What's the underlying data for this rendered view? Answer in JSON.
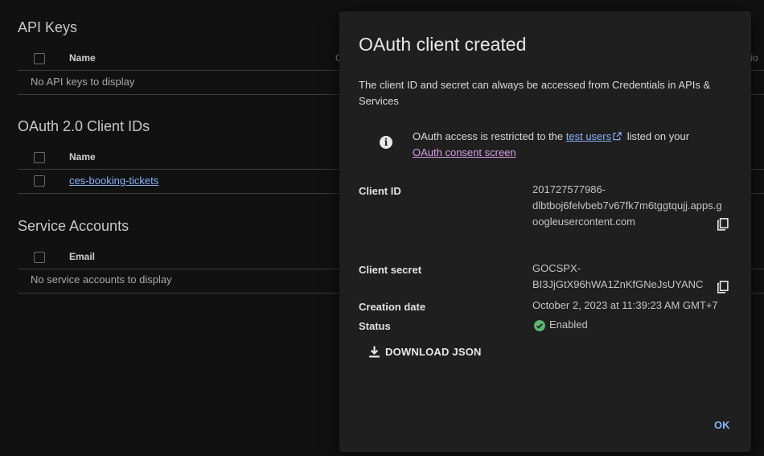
{
  "api_keys": {
    "title": "API Keys",
    "col_name": "Name",
    "col_clip": "C",
    "col_clip_right": "tio",
    "empty": "No API keys to display"
  },
  "oauth": {
    "title": "OAuth 2.0 Client IDs",
    "col_name": "Name",
    "rows": [
      {
        "name": "ces-booking-tickets"
      }
    ]
  },
  "service_accounts": {
    "title": "Service Accounts",
    "col_email": "Email",
    "empty": "No service accounts to display"
  },
  "dialog": {
    "title": "OAuth client created",
    "description": "The client ID and secret can always be accessed from Credentials in APIs & Services",
    "info_prefix": "OAuth access is restricted to the ",
    "info_link_test_users": "test users",
    "info_middle": " listed on your ",
    "info_link_consent": "OAuth consent screen",
    "client_id_label": "Client ID",
    "client_id_lines": [
      "201727577986-",
      "dlbtboj6felvbeb7v67fk7m6tggtqujj.apps.g",
      "oogleusercontent.com"
    ],
    "client_secret_label": "Client secret",
    "client_secret_lines": [
      "GOCSPX-",
      "BI3JjGtX96hWA1ZnKfGNeJsUYANC"
    ],
    "creation_date_label": "Creation date",
    "creation_date": "October 2, 2023 at 11:39:23 AM GMT+7",
    "status_label": "Status",
    "status": "Enabled",
    "download_label": "DOWNLOAD JSON",
    "ok_label": "OK"
  },
  "colors": {
    "link": "#8ab4f8",
    "visited_link": "#d69ee8",
    "status_green": "#5bb974",
    "dialog_bg": "#1f1f1f",
    "page_bg": "#111112"
  },
  "icons": [
    "info-icon",
    "open-in-new-icon",
    "copy-icon",
    "check-circle-icon",
    "download-icon"
  ]
}
